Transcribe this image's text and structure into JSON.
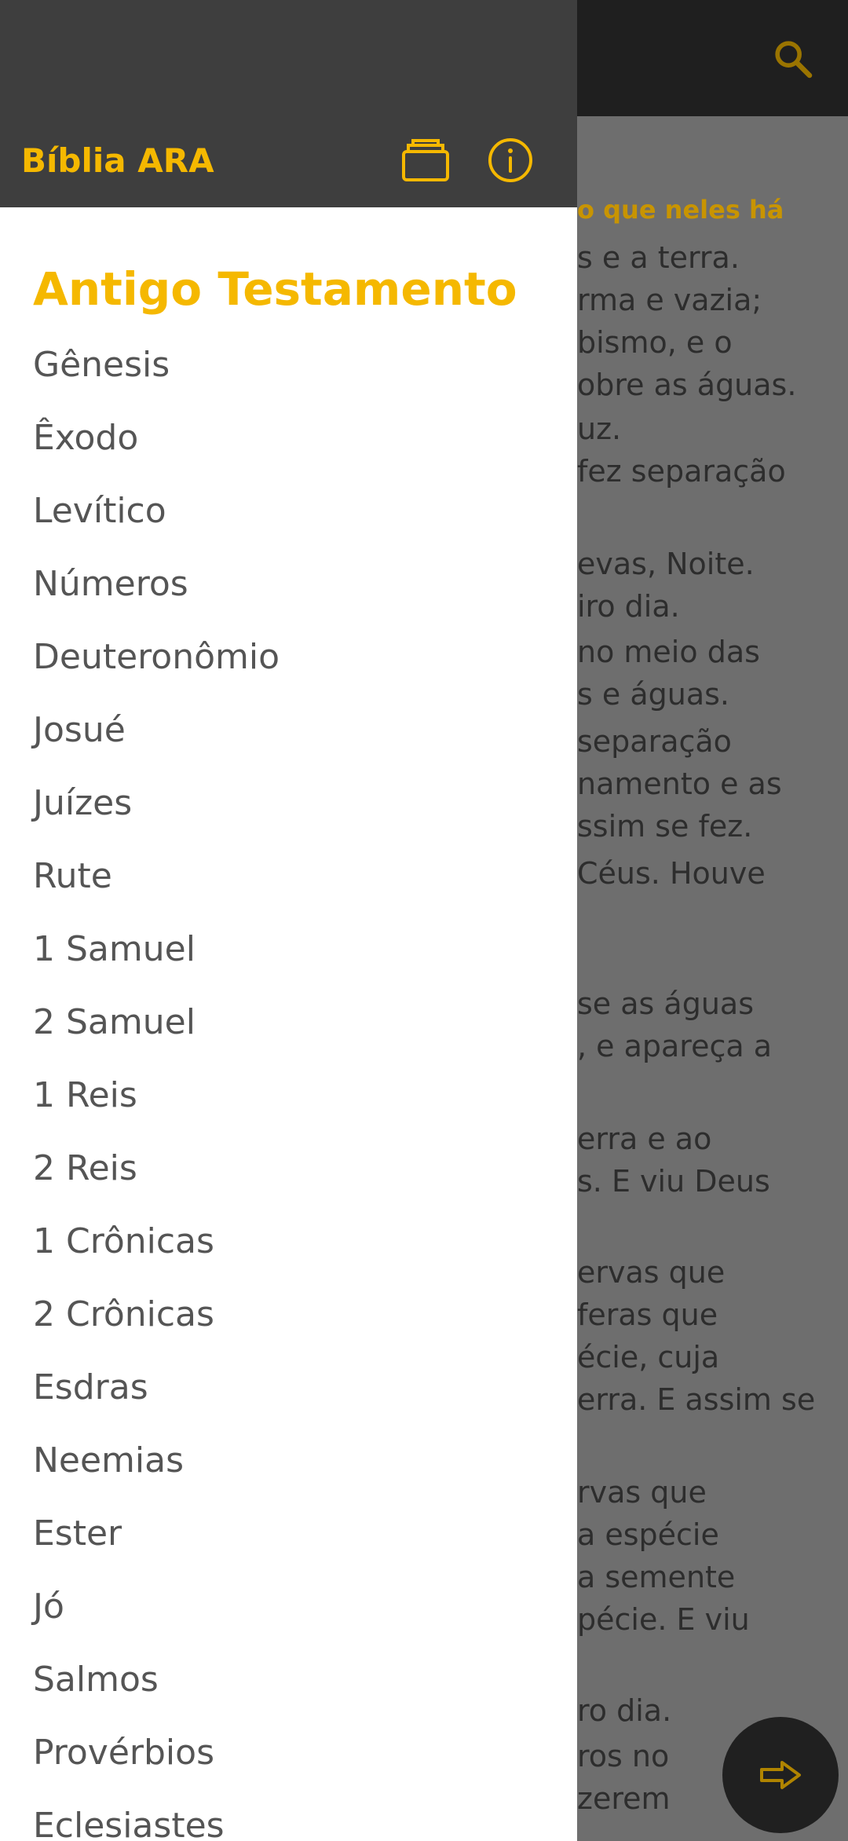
{
  "background": {
    "verses_partial": [
      {
        "text": "o que neles há",
        "heading": true
      },
      {
        "text": "s e a terra."
      },
      {
        "text": "rma e vazia;"
      },
      {
        "text": "bismo, e o"
      },
      {
        "text": "obre as águas."
      },
      {
        "text": "uz."
      },
      {
        "text": "fez separação"
      },
      {
        "text": "evas, Noite."
      },
      {
        "text": "iro dia."
      },
      {
        "text": "no meio das"
      },
      {
        "text": "s e águas."
      },
      {
        "text": "separação"
      },
      {
        "text": "namento e as"
      },
      {
        "text": "ssim se fez."
      },
      {
        "text": "Céus. Houve"
      },
      {
        "text": "se as águas"
      },
      {
        "text": ", e apareça a"
      },
      {
        "text": "erra e ao"
      },
      {
        "text": "s. E viu Deus"
      },
      {
        "text": "ervas que"
      },
      {
        "text": "feras que"
      },
      {
        "text": "écie, cuja"
      },
      {
        "text": "erra. E assim se"
      },
      {
        "text": "rvas que"
      },
      {
        "text": "a espécie"
      },
      {
        "text": "a semente"
      },
      {
        "text": "pécie. E viu"
      },
      {
        "text": "ro dia."
      },
      {
        "text": "ros no"
      },
      {
        "text": "zerem"
      }
    ]
  },
  "drawer": {
    "title": "Bíblia ARA",
    "section_title": "Antigo Testamento",
    "books": [
      "Gênesis",
      "Êxodo",
      "Levítico",
      "Números",
      "Deuteronômio",
      "Josué",
      "Juízes",
      "Rute",
      "1 Samuel",
      "2 Samuel",
      "1 Reis",
      "2 Reis",
      "1 Crônicas",
      "2 Crônicas",
      "Esdras",
      "Neemias",
      "Ester",
      "Jó",
      "Salmos",
      "Provérbios",
      "Eclesiastes"
    ]
  },
  "colors": {
    "accent": "#f5b800",
    "drawer_header": "#3e3e3e",
    "list_text": "#555555"
  }
}
